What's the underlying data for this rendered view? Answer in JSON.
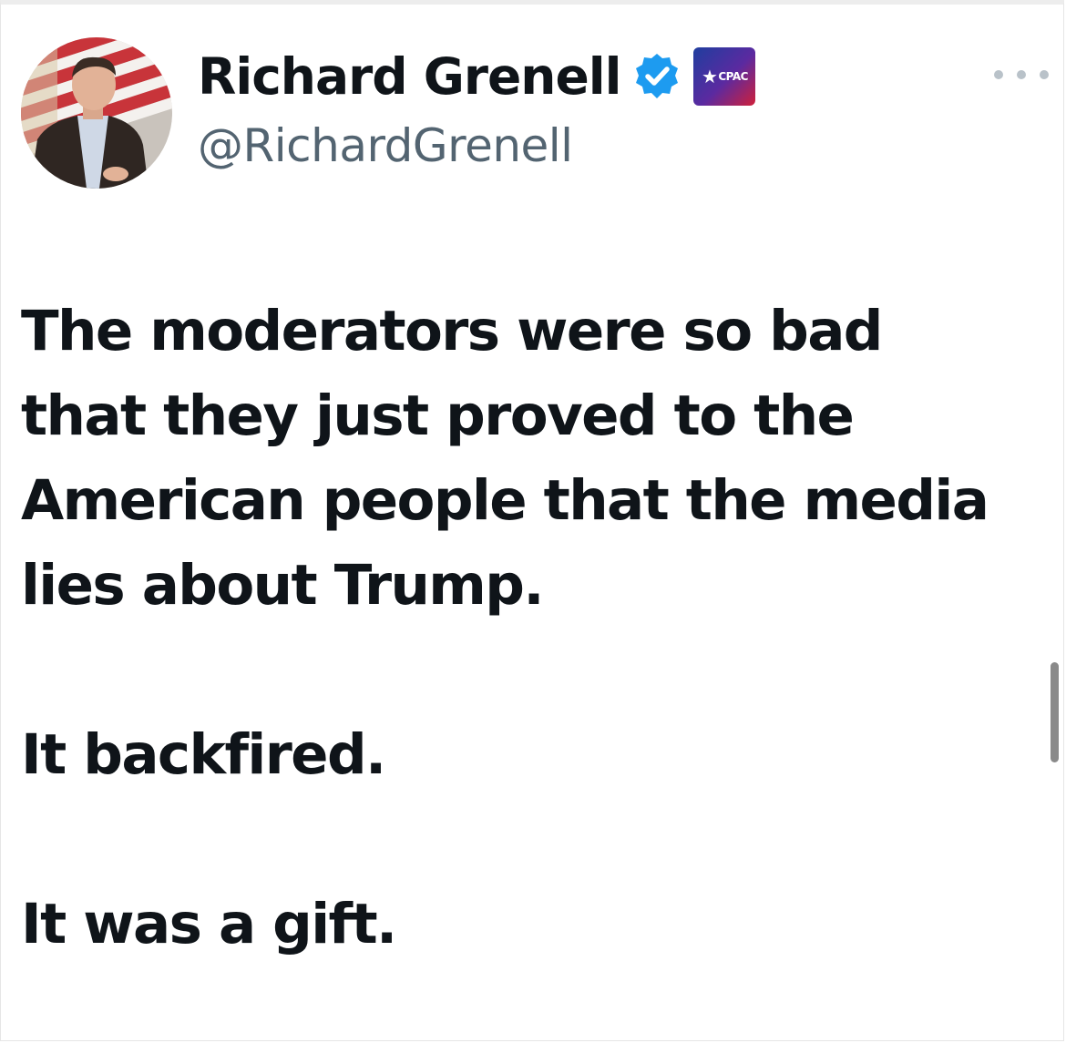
{
  "tweet": {
    "author": {
      "display_name": "Richard Grenell",
      "handle": "@RichardGrenell",
      "verified_icon": "verified-badge-icon",
      "affiliate_badge_text": "CPAC",
      "avatar_icon": "avatar"
    },
    "more_icon": "more-options-icon",
    "text_lines": [
      "The moderators were so bad",
      "that they just proved to the",
      "American people that the media",
      "lies about Trump.",
      "",
      "It backfired.",
      "",
      "It was a gift."
    ]
  },
  "colors": {
    "text_primary": "#0f1419",
    "text_secondary": "#536471",
    "verified_blue": "#1d9bf0",
    "dots": "#b9c2c9"
  }
}
